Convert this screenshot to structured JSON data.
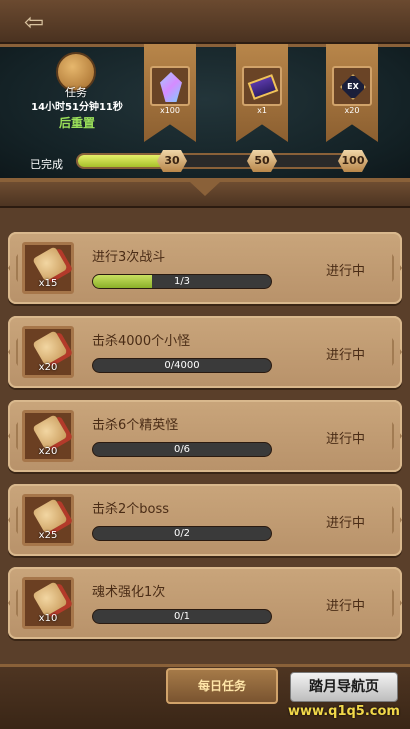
{
  "header": {
    "task_badge_label": "任务",
    "timer_text": "14小时51分钟11秒",
    "reset_label": "后重置",
    "completed_label": "已完成",
    "progress_fraction": 0.33,
    "milestones": [
      "30",
      "50",
      "100"
    ]
  },
  "rewards": [
    {
      "icon": "crystal-gem-icon",
      "count": "x100"
    },
    {
      "icon": "ticket-icon",
      "count": "x1"
    },
    {
      "icon": "ex-emblem-icon",
      "label": "EX",
      "count": "x20"
    }
  ],
  "tasks": [
    {
      "title": "进行3次战斗",
      "qty": "x15",
      "progress_text": "1/3",
      "progress": 0.333,
      "status": "进行中"
    },
    {
      "title": "击杀4000个小怪",
      "qty": "x20",
      "progress_text": "0/4000",
      "progress": 0,
      "status": "进行中"
    },
    {
      "title": "击杀6个精英怪",
      "qty": "x20",
      "progress_text": "0/6",
      "progress": 0,
      "status": "进行中"
    },
    {
      "title": "击杀2个boss",
      "qty": "x25",
      "progress_text": "0/2",
      "progress": 0,
      "status": "进行中"
    },
    {
      "title": "魂术强化1次",
      "qty": "x10",
      "progress_text": "0/1",
      "progress": 0,
      "status": "进行中"
    }
  ],
  "bottom": {
    "daily_tab_label": "每日任务",
    "watermark_name": "踏月导航页",
    "watermark_url": "www.q1q5.com"
  },
  "colors": {
    "progress_green": "#a6c02a",
    "reset_green": "#9be05a",
    "card_bg": "#c9a57b",
    "panel_dark": "#142226"
  }
}
